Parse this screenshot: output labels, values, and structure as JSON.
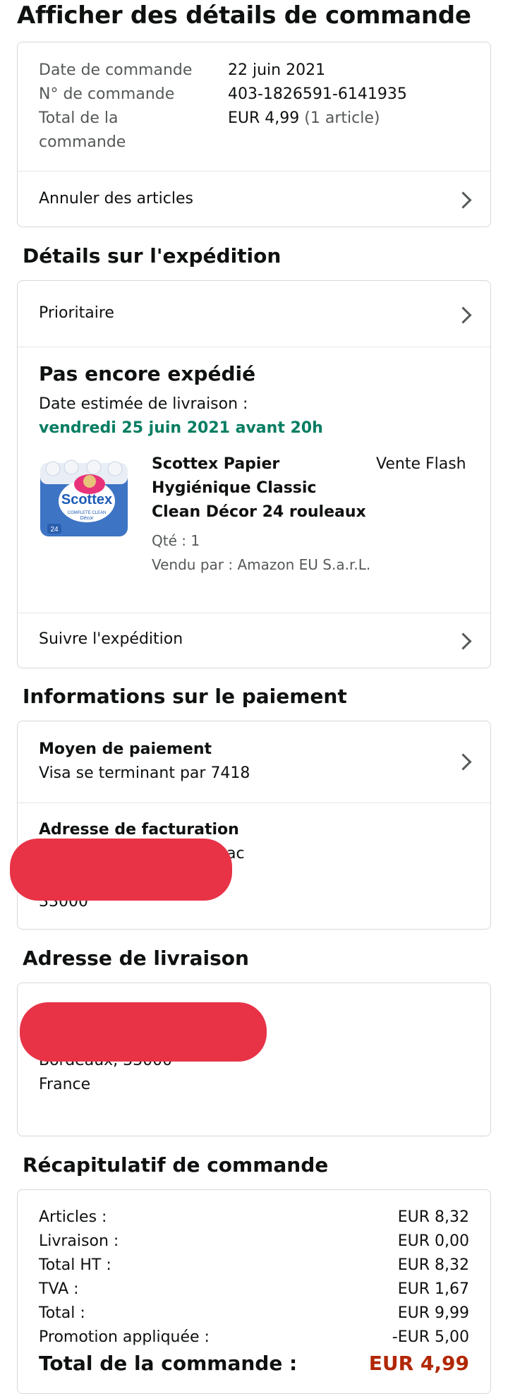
{
  "page_title": "Afficher des détails de commande",
  "order": {
    "date_label": "Date de commande",
    "date_value": "22 juin 2021",
    "number_label": "N° de commande",
    "number_value": "403-1826591-6141935",
    "total_label_1": "Total de la",
    "total_label_2": "commande",
    "total_value": "EUR 4,99",
    "total_count": "(1 article)",
    "cancel_label": "Annuler des articles"
  },
  "shipping": {
    "section_title": "Détails sur l'expédition",
    "speed": "Prioritaire",
    "status": "Pas encore expédié",
    "estimated_label": "Date estimée de livraison :",
    "estimated_value": "vendredi 25 juin 2021 avant 20h",
    "product_name_1": "Scottex Papier",
    "product_name_2": "Hygiénique Classic",
    "product_name_3": "Clean Décor 24 rouleaux",
    "deal_badge": "Vente Flash",
    "qty": "Qté : 1",
    "sold_by": "Vendu par : Amazon EU S.a.r.L.",
    "track_label": "Suivre l'expédition",
    "product_image_brand": "Scottex",
    "product_image_sub": "COMPLETE CLEAN",
    "product_image_sub2": "Décor",
    "product_image_count": "24"
  },
  "payment": {
    "section_title": "Informations sur le paiement",
    "method_title": "Moyen de paiement",
    "method_value": "Visa se terminant par 7418",
    "billing_title": "Adresse de facturation",
    "billing_partial": "ac",
    "billing_zip": "33000"
  },
  "delivery": {
    "section_title": "Adresse de livraison",
    "city_line": "Bordeaux, 33000",
    "country": "France"
  },
  "summary": {
    "section_title": "Récapitulatif de commande",
    "rows": [
      {
        "label": "Articles :",
        "value": "EUR 8,32"
      },
      {
        "label": "Livraison :",
        "value": "EUR 0,00"
      },
      {
        "label": "Total HT :",
        "value": "EUR 8,32"
      },
      {
        "label": "TVA :",
        "value": "EUR 1,67"
      },
      {
        "label": "Total :",
        "value": "EUR 9,99"
      },
      {
        "label": "Promotion appliquée :",
        "value": "-EUR 5,00"
      }
    ],
    "grand_total_label": "Total de la commande :",
    "grand_total_value": "EUR 4,99"
  },
  "colors": {
    "accent_green": "#067d62",
    "price_red": "#b12704",
    "redaction": "#e83347"
  }
}
